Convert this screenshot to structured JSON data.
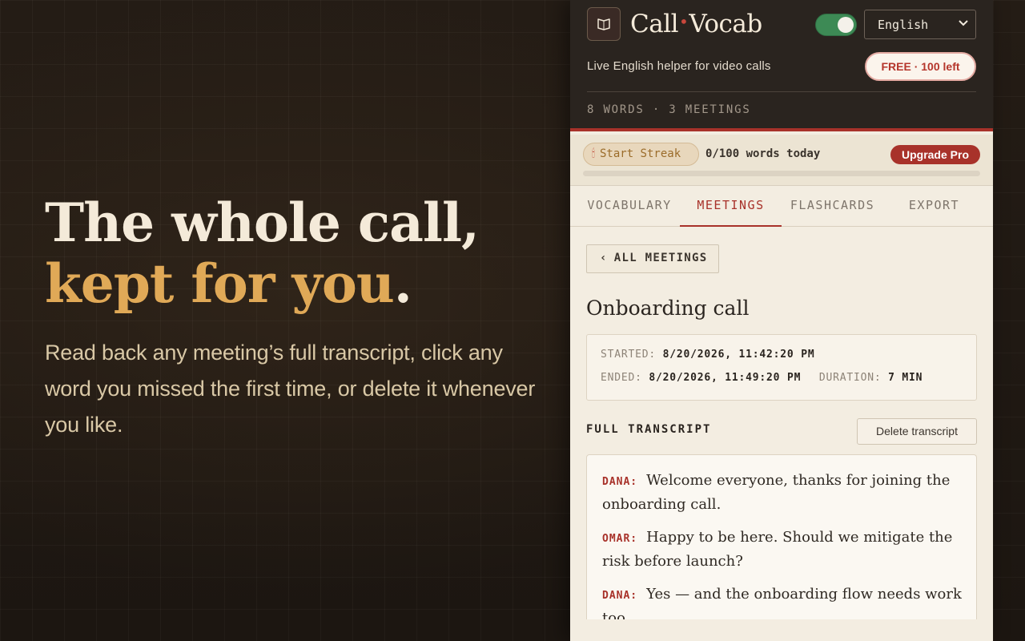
{
  "hero": {
    "title_line1": "The whole call,",
    "title_line2": "kept for you",
    "title_dot": ".",
    "subtitle": "Read back any meeting’s full transcript, click any word you missed the first time, or delete it whenever you like."
  },
  "app": {
    "brand_part1": "Call",
    "brand_sep": "•",
    "brand_part2": "Vocab",
    "toggle_on": true,
    "language": "English",
    "tagline": "Live English helper for video calls",
    "plan_badge": "FREE · 100 left",
    "stats": "8 WORDS · 3 MEETINGS"
  },
  "streak": {
    "label": "Start Streak",
    "icon": "flame-icon",
    "words_today": "0/100 words today",
    "progress_fraction": 0,
    "upgrade_label": "Upgrade Pro"
  },
  "tabs": [
    {
      "label": "VOCABULARY",
      "active": false
    },
    {
      "label": "MEETINGS",
      "active": true
    },
    {
      "label": "FLASHCARDS",
      "active": false
    },
    {
      "label": "EXPORT",
      "active": false
    }
  ],
  "meeting": {
    "back_label": "ALL MEETINGS",
    "title": "Onboarding call",
    "started_label": "STARTED:",
    "started_value": "8/20/2026, 11:42:20 PM",
    "ended_label": "ENDED:",
    "ended_value": "8/20/2026, 11:49:20 PM",
    "duration_label": "DURATION:",
    "duration_value": "7 MIN",
    "transcript_label": "FULL TRANSCRIPT",
    "delete_label": "Delete transcript",
    "transcript": [
      {
        "speaker": "DANA:",
        "text": "Welcome everyone, thanks for joining the onboarding call."
      },
      {
        "speaker": "OMAR:",
        "text": "Happy to be here. Should we mitigate the risk before launch?"
      },
      {
        "speaker": "DANA:",
        "text": "Yes — and the onboarding flow needs work too."
      }
    ]
  },
  "colors": {
    "accent": "#a8322a",
    "hero_highlight": "#e0a957",
    "toggle_on": "#3d8a55",
    "header_bg": "#2a241f",
    "panel_bg": "#f3ede1"
  }
}
